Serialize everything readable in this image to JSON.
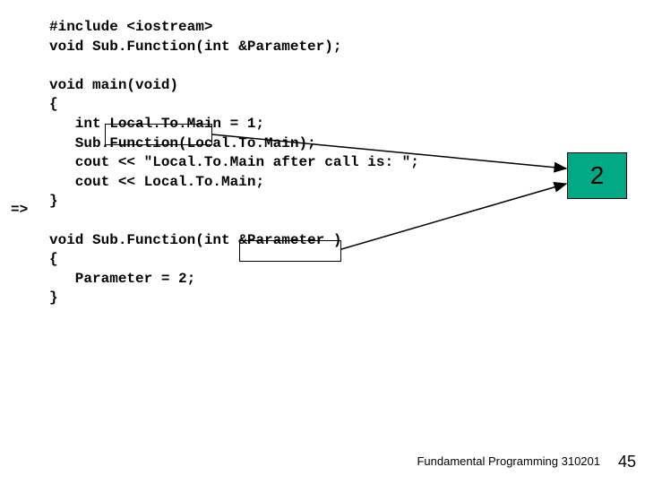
{
  "code": {
    "l1": "#include <iostream>",
    "l2": "void Sub.Function(int &Parameter);",
    "l3": "",
    "l4": "void main(void)",
    "l5": "{",
    "l6": "   int Local.To.Main = 1;",
    "l7": "   Sub.Function(Local.To.Main);",
    "l8": "   cout << \"Local.To.Main after call is: \";",
    "l9": "   cout << Local.To.Main;",
    "l10": "}",
    "l11": "",
    "l12": "void Sub.Function(int &Parameter )",
    "l13": "{",
    "l14": "   Parameter = 2;",
    "l15": "}"
  },
  "pointer_symbol": "=>",
  "value_box": "2",
  "footer": "Fundamental Programming 310201",
  "page": "45",
  "highlighted_tokens": {
    "var1": "Local.To.Main",
    "var2": "&Parameter"
  }
}
